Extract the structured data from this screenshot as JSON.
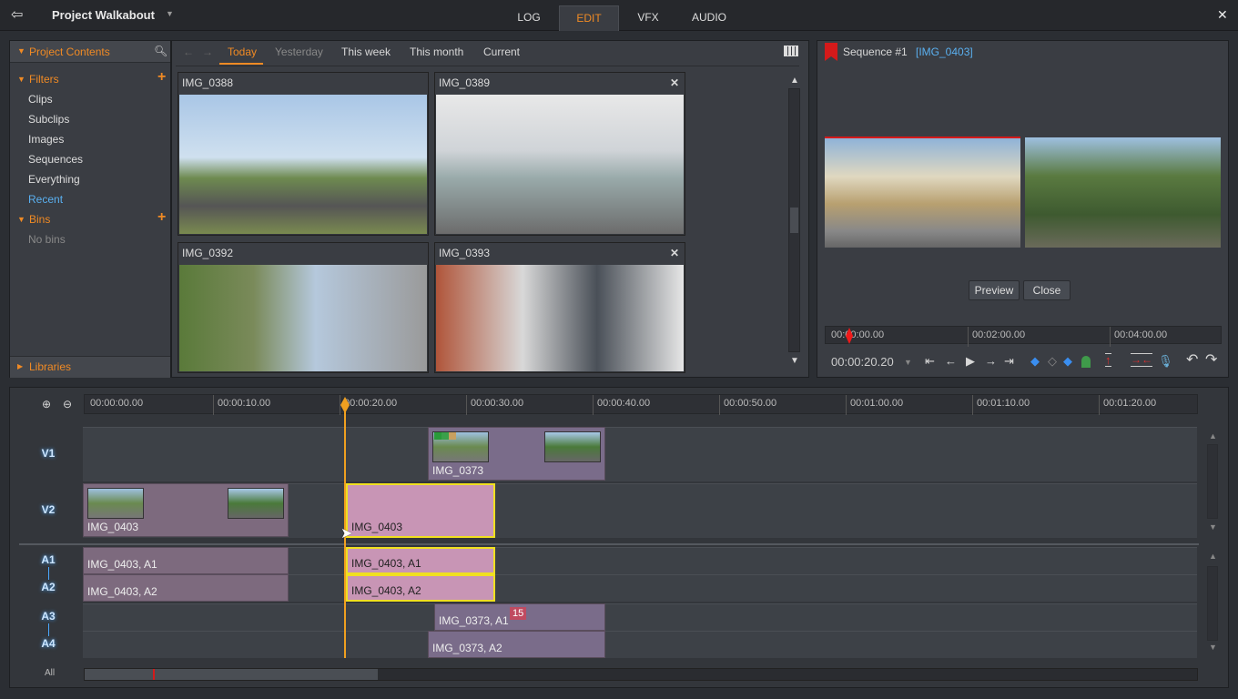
{
  "app": {
    "project_title": "Project Walkabout",
    "tabs": [
      "LOG",
      "EDIT",
      "VFX",
      "AUDIO"
    ],
    "active_tab": "EDIT",
    "accent": "#f08a24"
  },
  "left_panel": {
    "title": "Project Contents",
    "filters_label": "Filters",
    "filters": [
      "Clips",
      "Subclips",
      "Images",
      "Sequences",
      "Everything",
      "Recent"
    ],
    "active_filter": "Recent",
    "bins_label": "Bins",
    "bins_empty": "No bins",
    "libraries_label": "Libraries"
  },
  "browser": {
    "tabs": [
      "Today",
      "Yesterday",
      "This week",
      "This month",
      "Current"
    ],
    "active_tab": "Today",
    "thumbnails": [
      {
        "name": "IMG_0388"
      },
      {
        "name": "IMG_0389"
      },
      {
        "name": "IMG_0392"
      },
      {
        "name": "IMG_0393"
      }
    ]
  },
  "viewer": {
    "title": "Sequence #1",
    "clip": "[IMG_0403]",
    "preview_label": "Preview",
    "close_label": "Close",
    "ruler": [
      "00:00:00.00",
      "00:02:00.00",
      "00:04:00.00"
    ],
    "timecode": "00:00:20.20"
  },
  "timeline": {
    "ruler": [
      "00:00:00.00",
      "00:00:10.00",
      "00:00:20.00",
      "00:00:30.00",
      "00:00:40.00",
      "00:00:50.00",
      "00:01:00.00",
      "00:01:10.00",
      "00:01:20.00"
    ],
    "tracks": [
      "V1",
      "V2",
      "A1",
      "A2",
      "A3",
      "A4"
    ],
    "all_label": "All",
    "clips": {
      "v1": "IMG_0373",
      "v2a": "IMG_0403",
      "v2b": "IMG_0403",
      "a1a": "IMG_0403, A1",
      "a2a": "IMG_0403, A2",
      "a1b": "IMG_0403, A1",
      "a2b": "IMG_0403, A2",
      "a3": "IMG_0373, A1",
      "a4": "IMG_0373, A2",
      "badge": "15"
    },
    "playhead_time": "00:00:20.20"
  }
}
